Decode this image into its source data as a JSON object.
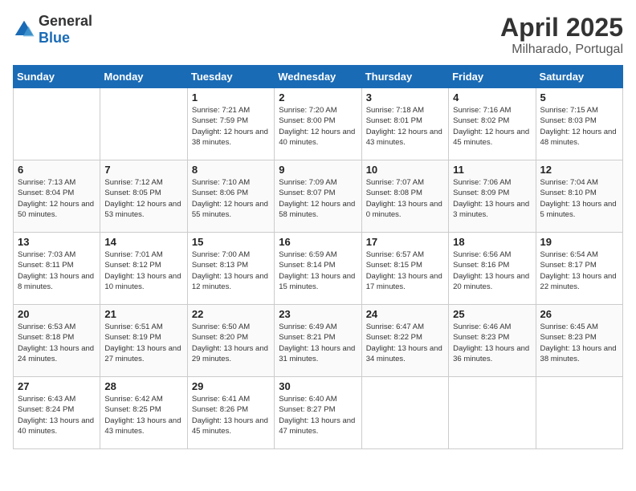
{
  "header": {
    "logo_general": "General",
    "logo_blue": "Blue",
    "month": "April 2025",
    "location": "Milharado, Portugal"
  },
  "weekdays": [
    "Sunday",
    "Monday",
    "Tuesday",
    "Wednesday",
    "Thursday",
    "Friday",
    "Saturday"
  ],
  "weeks": [
    [
      {
        "day": "",
        "sunrise": "",
        "sunset": "",
        "daylight": ""
      },
      {
        "day": "",
        "sunrise": "",
        "sunset": "",
        "daylight": ""
      },
      {
        "day": "1",
        "sunrise": "Sunrise: 7:21 AM",
        "sunset": "Sunset: 7:59 PM",
        "daylight": "Daylight: 12 hours and 38 minutes."
      },
      {
        "day": "2",
        "sunrise": "Sunrise: 7:20 AM",
        "sunset": "Sunset: 8:00 PM",
        "daylight": "Daylight: 12 hours and 40 minutes."
      },
      {
        "day": "3",
        "sunrise": "Sunrise: 7:18 AM",
        "sunset": "Sunset: 8:01 PM",
        "daylight": "Daylight: 12 hours and 43 minutes."
      },
      {
        "day": "4",
        "sunrise": "Sunrise: 7:16 AM",
        "sunset": "Sunset: 8:02 PM",
        "daylight": "Daylight: 12 hours and 45 minutes."
      },
      {
        "day": "5",
        "sunrise": "Sunrise: 7:15 AM",
        "sunset": "Sunset: 8:03 PM",
        "daylight": "Daylight: 12 hours and 48 minutes."
      }
    ],
    [
      {
        "day": "6",
        "sunrise": "Sunrise: 7:13 AM",
        "sunset": "Sunset: 8:04 PM",
        "daylight": "Daylight: 12 hours and 50 minutes."
      },
      {
        "day": "7",
        "sunrise": "Sunrise: 7:12 AM",
        "sunset": "Sunset: 8:05 PM",
        "daylight": "Daylight: 12 hours and 53 minutes."
      },
      {
        "day": "8",
        "sunrise": "Sunrise: 7:10 AM",
        "sunset": "Sunset: 8:06 PM",
        "daylight": "Daylight: 12 hours and 55 minutes."
      },
      {
        "day": "9",
        "sunrise": "Sunrise: 7:09 AM",
        "sunset": "Sunset: 8:07 PM",
        "daylight": "Daylight: 12 hours and 58 minutes."
      },
      {
        "day": "10",
        "sunrise": "Sunrise: 7:07 AM",
        "sunset": "Sunset: 8:08 PM",
        "daylight": "Daylight: 13 hours and 0 minutes."
      },
      {
        "day": "11",
        "sunrise": "Sunrise: 7:06 AM",
        "sunset": "Sunset: 8:09 PM",
        "daylight": "Daylight: 13 hours and 3 minutes."
      },
      {
        "day": "12",
        "sunrise": "Sunrise: 7:04 AM",
        "sunset": "Sunset: 8:10 PM",
        "daylight": "Daylight: 13 hours and 5 minutes."
      }
    ],
    [
      {
        "day": "13",
        "sunrise": "Sunrise: 7:03 AM",
        "sunset": "Sunset: 8:11 PM",
        "daylight": "Daylight: 13 hours and 8 minutes."
      },
      {
        "day": "14",
        "sunrise": "Sunrise: 7:01 AM",
        "sunset": "Sunset: 8:12 PM",
        "daylight": "Daylight: 13 hours and 10 minutes."
      },
      {
        "day": "15",
        "sunrise": "Sunrise: 7:00 AM",
        "sunset": "Sunset: 8:13 PM",
        "daylight": "Daylight: 13 hours and 12 minutes."
      },
      {
        "day": "16",
        "sunrise": "Sunrise: 6:59 AM",
        "sunset": "Sunset: 8:14 PM",
        "daylight": "Daylight: 13 hours and 15 minutes."
      },
      {
        "day": "17",
        "sunrise": "Sunrise: 6:57 AM",
        "sunset": "Sunset: 8:15 PM",
        "daylight": "Daylight: 13 hours and 17 minutes."
      },
      {
        "day": "18",
        "sunrise": "Sunrise: 6:56 AM",
        "sunset": "Sunset: 8:16 PM",
        "daylight": "Daylight: 13 hours and 20 minutes."
      },
      {
        "day": "19",
        "sunrise": "Sunrise: 6:54 AM",
        "sunset": "Sunset: 8:17 PM",
        "daylight": "Daylight: 13 hours and 22 minutes."
      }
    ],
    [
      {
        "day": "20",
        "sunrise": "Sunrise: 6:53 AM",
        "sunset": "Sunset: 8:18 PM",
        "daylight": "Daylight: 13 hours and 24 minutes."
      },
      {
        "day": "21",
        "sunrise": "Sunrise: 6:51 AM",
        "sunset": "Sunset: 8:19 PM",
        "daylight": "Daylight: 13 hours and 27 minutes."
      },
      {
        "day": "22",
        "sunrise": "Sunrise: 6:50 AM",
        "sunset": "Sunset: 8:20 PM",
        "daylight": "Daylight: 13 hours and 29 minutes."
      },
      {
        "day": "23",
        "sunrise": "Sunrise: 6:49 AM",
        "sunset": "Sunset: 8:21 PM",
        "daylight": "Daylight: 13 hours and 31 minutes."
      },
      {
        "day": "24",
        "sunrise": "Sunrise: 6:47 AM",
        "sunset": "Sunset: 8:22 PM",
        "daylight": "Daylight: 13 hours and 34 minutes."
      },
      {
        "day": "25",
        "sunrise": "Sunrise: 6:46 AM",
        "sunset": "Sunset: 8:23 PM",
        "daylight": "Daylight: 13 hours and 36 minutes."
      },
      {
        "day": "26",
        "sunrise": "Sunrise: 6:45 AM",
        "sunset": "Sunset: 8:23 PM",
        "daylight": "Daylight: 13 hours and 38 minutes."
      }
    ],
    [
      {
        "day": "27",
        "sunrise": "Sunrise: 6:43 AM",
        "sunset": "Sunset: 8:24 PM",
        "daylight": "Daylight: 13 hours and 40 minutes."
      },
      {
        "day": "28",
        "sunrise": "Sunrise: 6:42 AM",
        "sunset": "Sunset: 8:25 PM",
        "daylight": "Daylight: 13 hours and 43 minutes."
      },
      {
        "day": "29",
        "sunrise": "Sunrise: 6:41 AM",
        "sunset": "Sunset: 8:26 PM",
        "daylight": "Daylight: 13 hours and 45 minutes."
      },
      {
        "day": "30",
        "sunrise": "Sunrise: 6:40 AM",
        "sunset": "Sunset: 8:27 PM",
        "daylight": "Daylight: 13 hours and 47 minutes."
      },
      {
        "day": "",
        "sunrise": "",
        "sunset": "",
        "daylight": ""
      },
      {
        "day": "",
        "sunrise": "",
        "sunset": "",
        "daylight": ""
      },
      {
        "day": "",
        "sunrise": "",
        "sunset": "",
        "daylight": ""
      }
    ]
  ]
}
